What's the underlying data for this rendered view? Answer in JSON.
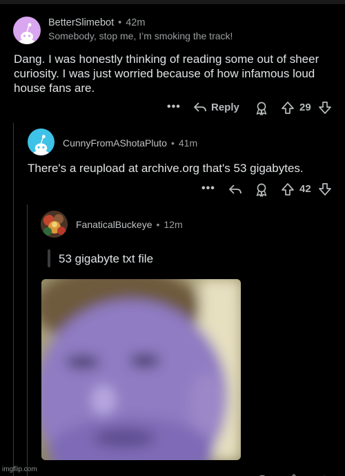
{
  "comment1": {
    "username": "BetterSlimebot",
    "separator": "•",
    "time": "42m",
    "flair": "Somebody, stop me, I’m smoking the track!",
    "body": "Dang. I was honestly thinking of reading some out of sheer curiosity. I was just worried because of how infamous loud house fans are.",
    "more_label": "•••",
    "reply_label": "Reply",
    "vote_count": "29"
  },
  "comment2": {
    "username": "CunnyFromAShotaPluto",
    "separator": "•",
    "time": "41m",
    "body": "There's a reupload at archive.org that's 53 gigabytes.",
    "more_label": "•••",
    "vote_count": "42"
  },
  "comment3": {
    "username": "FanaticalBuckeye",
    "separator": "•",
    "time": "12m",
    "quote": "53 gigabyte txt file"
  },
  "watermark": "imgflip.com",
  "colors": {
    "background": "#000000",
    "text": "#e0e3e5",
    "muted": "#9a9d9f",
    "thread_line": "#3a3c3e",
    "avatar1": "#d9a6f0",
    "avatar2": "#3fc2e8"
  },
  "icons": [
    "snoo-avatar-icon",
    "reply-arrow-icon",
    "award-icon",
    "upvote-icon",
    "downvote-icon",
    "more-icon"
  ]
}
